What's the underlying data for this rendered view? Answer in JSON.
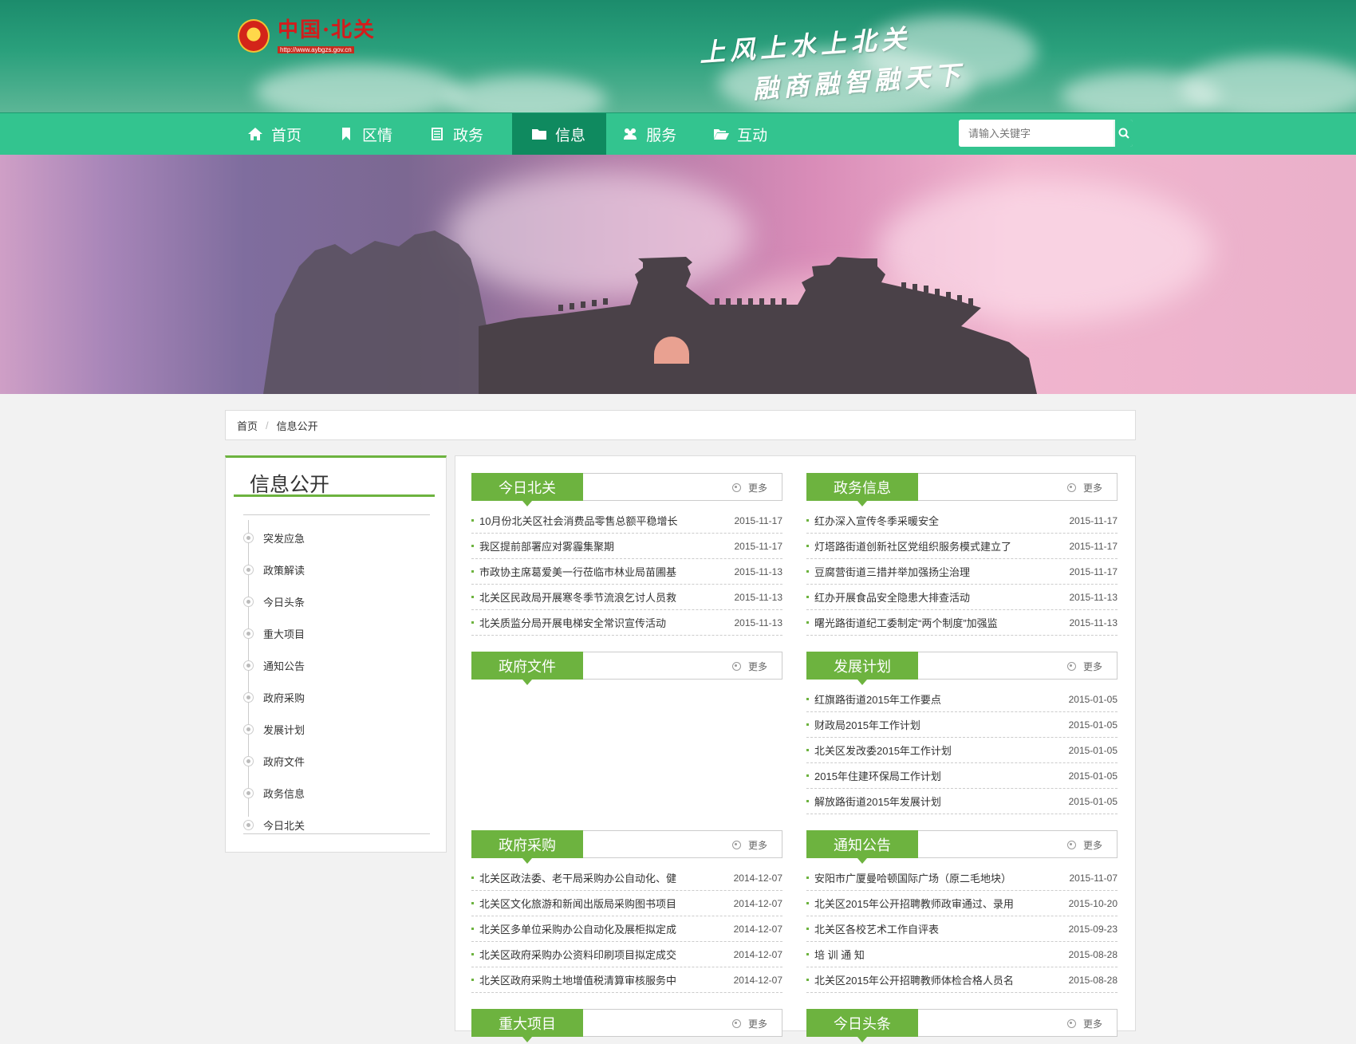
{
  "header": {
    "logo_text": "中国·北关",
    "logo_url": "http://www.aybgzs.gov.cn",
    "slogan_line1": "上风上水上北关",
    "slogan_line2": "融商融智融天下"
  },
  "nav": {
    "items": [
      {
        "label": "首页",
        "icon": "home-icon"
      },
      {
        "label": "区情",
        "icon": "bookmark-icon"
      },
      {
        "label": "政务",
        "icon": "list-icon"
      },
      {
        "label": "信息",
        "icon": "folder-icon"
      },
      {
        "label": "服务",
        "icon": "users-icon"
      },
      {
        "label": "互动",
        "icon": "folder-open-icon"
      }
    ],
    "active": "信息",
    "search_placeholder": "请输入关键字"
  },
  "breadcrumb": {
    "home": "首页",
    "separator": "/",
    "current": "信息公开"
  },
  "sidebar": {
    "title": "信息公开",
    "items": [
      "突发应急",
      "政策解读",
      "今日头条",
      "重大项目",
      "通知公告",
      "政府采购",
      "发展计划",
      "政府文件",
      "政务信息",
      "今日北关"
    ]
  },
  "more_label": "更多",
  "blocks": [
    {
      "title": "今日北关",
      "items": [
        {
          "title": "10月份北关区社会消费品零售总额平稳增长",
          "date": "2015-11-17"
        },
        {
          "title": "我区提前部署应对雾霾集聚期",
          "date": "2015-11-17"
        },
        {
          "title": "市政协主席葛爱美一行莅临市林业局苗圃基",
          "date": "2015-11-13"
        },
        {
          "title": "北关区民政局开展寒冬季节流浪乞讨人员救",
          "date": "2015-11-13"
        },
        {
          "title": "北关质监分局开展电梯安全常识宣传活动",
          "date": "2015-11-13"
        }
      ]
    },
    {
      "title": "政务信息",
      "items": [
        {
          "title": "红办深入宣传冬季采暖安全",
          "date": "2015-11-17"
        },
        {
          "title": "灯塔路街道创新社区党组织服务模式建立了",
          "date": "2015-11-17"
        },
        {
          "title": "豆腐营街道三措并举加强扬尘治理",
          "date": "2015-11-17"
        },
        {
          "title": "红办开展食品安全隐患大排查活动",
          "date": "2015-11-13"
        },
        {
          "title": "曙光路街道纪工委制定“两个制度”加强监",
          "date": "2015-11-13"
        }
      ]
    },
    {
      "title": "政府文件",
      "items": []
    },
    {
      "title": "发展计划",
      "items": [
        {
          "title": "红旗路街道2015年工作要点",
          "date": "2015-01-05"
        },
        {
          "title": "财政局2015年工作计划",
          "date": "2015-01-05"
        },
        {
          "title": "北关区发改委2015年工作计划",
          "date": "2015-01-05"
        },
        {
          "title": "2015年住建环保局工作计划",
          "date": "2015-01-05"
        },
        {
          "title": "解放路街道2015年发展计划",
          "date": "2015-01-05"
        }
      ]
    },
    {
      "title": "政府采购",
      "items": [
        {
          "title": "北关区政法委、老干局采购办公自动化、健",
          "date": "2014-12-07"
        },
        {
          "title": "北关区文化旅游和新闻出版局采购图书项目",
          "date": "2014-12-07"
        },
        {
          "title": "北关区多单位采购办公自动化及展柜拟定成",
          "date": "2014-12-07"
        },
        {
          "title": "北关区政府采购办公资料印刷项目拟定成交",
          "date": "2014-12-07"
        },
        {
          "title": "北关区政府采购土地增值税清算审核服务中",
          "date": "2014-12-07"
        }
      ]
    },
    {
      "title": "通知公告",
      "items": [
        {
          "title": "安阳市广厦曼哈顿国际广场（原二毛地块）",
          "date": "2015-11-07"
        },
        {
          "title": "北关区2015年公开招聘教师政审通过、录用",
          "date": "2015-10-20"
        },
        {
          "title": "北关区各校艺术工作自评表",
          "date": "2015-09-23"
        },
        {
          "title": "培 训 通 知",
          "date": "2015-08-28"
        },
        {
          "title": "北关区2015年公开招聘教师体检合格人员名",
          "date": "2015-08-28"
        }
      ]
    },
    {
      "title": "重大项目",
      "items": []
    },
    {
      "title": "今日头条",
      "items": []
    }
  ],
  "colors": {
    "header": "#2aa07c",
    "nav": "#33c48f",
    "nav_active": "#0f8a5f",
    "accent_green": "#6db33f"
  }
}
